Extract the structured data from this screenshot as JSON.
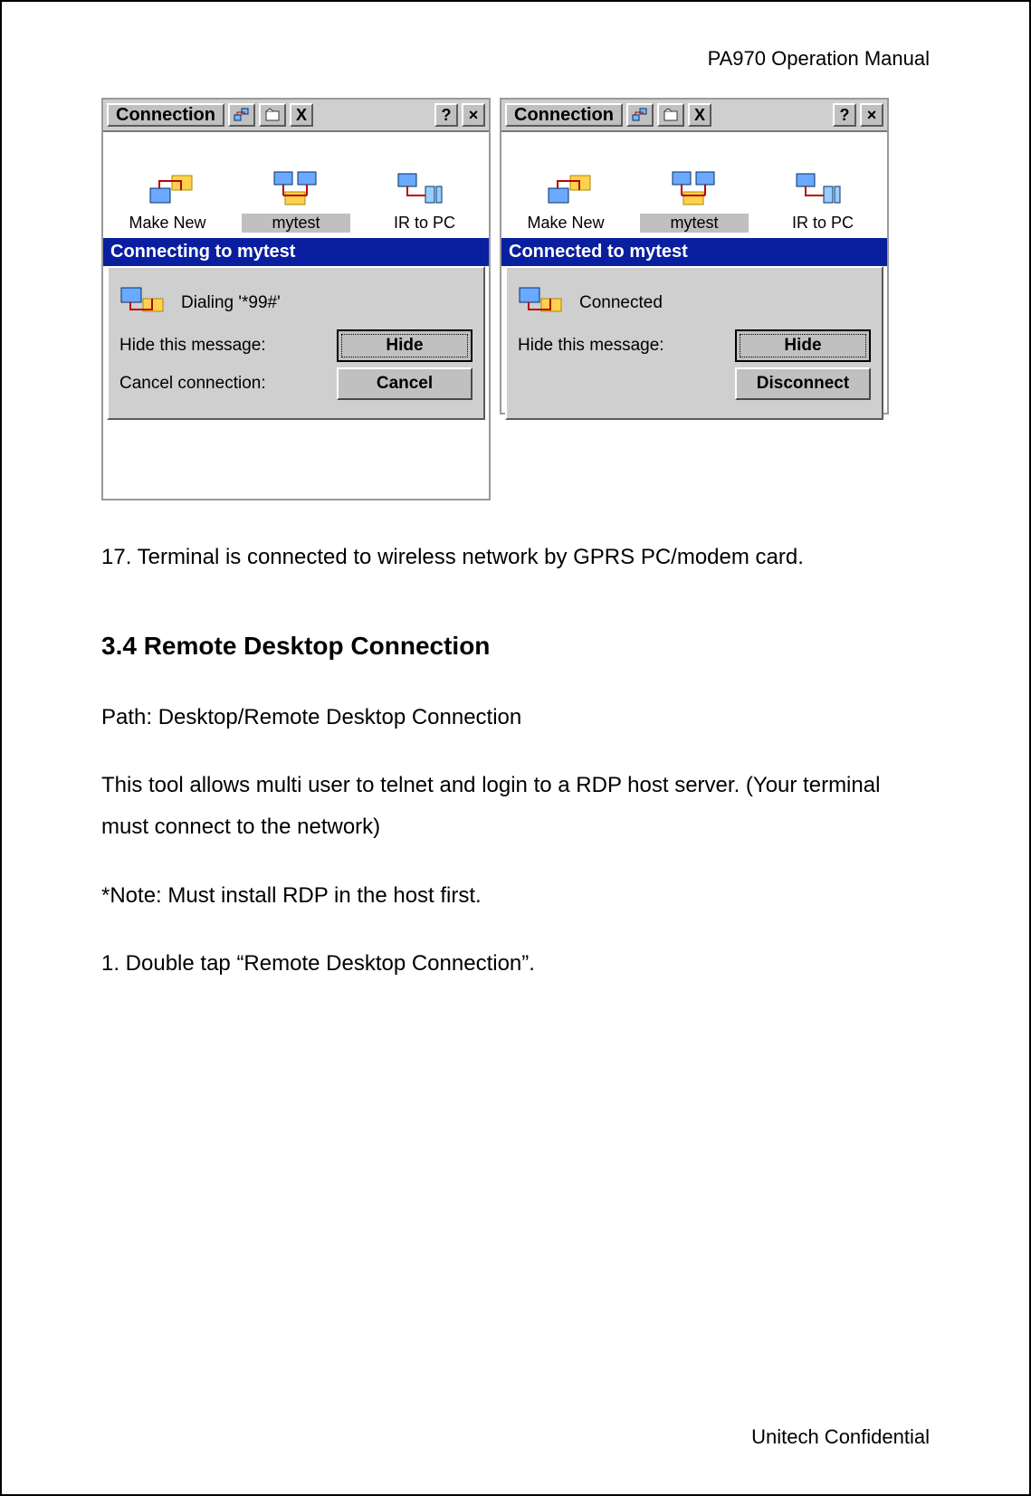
{
  "header": "PA970 Operation Manual",
  "footer": "Unitech Confidential",
  "win_common": {
    "title": "Connection",
    "help": "?",
    "close": "×",
    "x": "X",
    "icons": [
      "Make New",
      "mytest",
      "IR to PC"
    ],
    "hide_label": "Hide this message:",
    "hide_btn": "Hide"
  },
  "win1": {
    "bar": "Connecting to mytest",
    "status": "Dialing '*99#'",
    "cancel_label": "Cancel connection:",
    "cancel_btn": "Cancel"
  },
  "win2": {
    "bar": "Connected to mytest",
    "status": "Connected",
    "disc_btn": "Disconnect"
  },
  "doc": {
    "step17": "17. Terminal is connected to wireless network by GPRS PC/modem card.",
    "h2": "3.4   Remote Desktop Connection",
    "path": "Path: Desktop/Remote Desktop Connection",
    "desc": "This tool allows multi user to telnet and login to a RDP host server. (Your terminal must connect to the network)",
    "note": "*Note: Must install RDP in the host first.",
    "step1": "1. Double tap “Remote Desktop Connection”."
  }
}
